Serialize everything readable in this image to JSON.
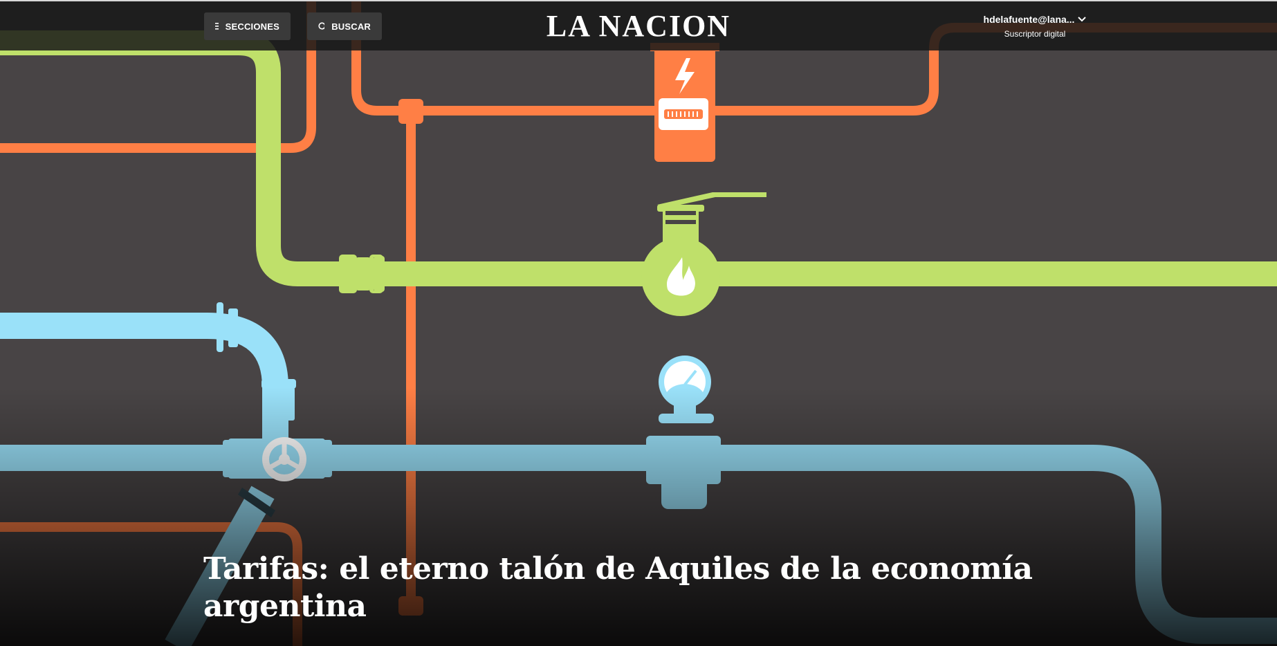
{
  "header": {
    "sections_label": "SECCIONES",
    "search_label": "BUSCAR",
    "logo_text": "LA NACION",
    "user_email": "hdelafuente@lana...",
    "user_subtitle": "Suscriptor digital"
  },
  "article": {
    "title": "Tarifas: el eterno talón de Aquiles de la economía argentina"
  },
  "colors": {
    "background": "#484445",
    "pipe_orange": "#ff7f45",
    "pipe_green": "#bfe06a",
    "pipe_blue": "#9ae1f9",
    "header_bar": "#181818"
  },
  "icons": {
    "menu": "hamburger-icon",
    "search": "search-icon",
    "dropdown": "chevron-down-icon",
    "electric": "lightning-bolt-icon",
    "gas": "flame-icon",
    "water": "pressure-gauge-icon"
  }
}
